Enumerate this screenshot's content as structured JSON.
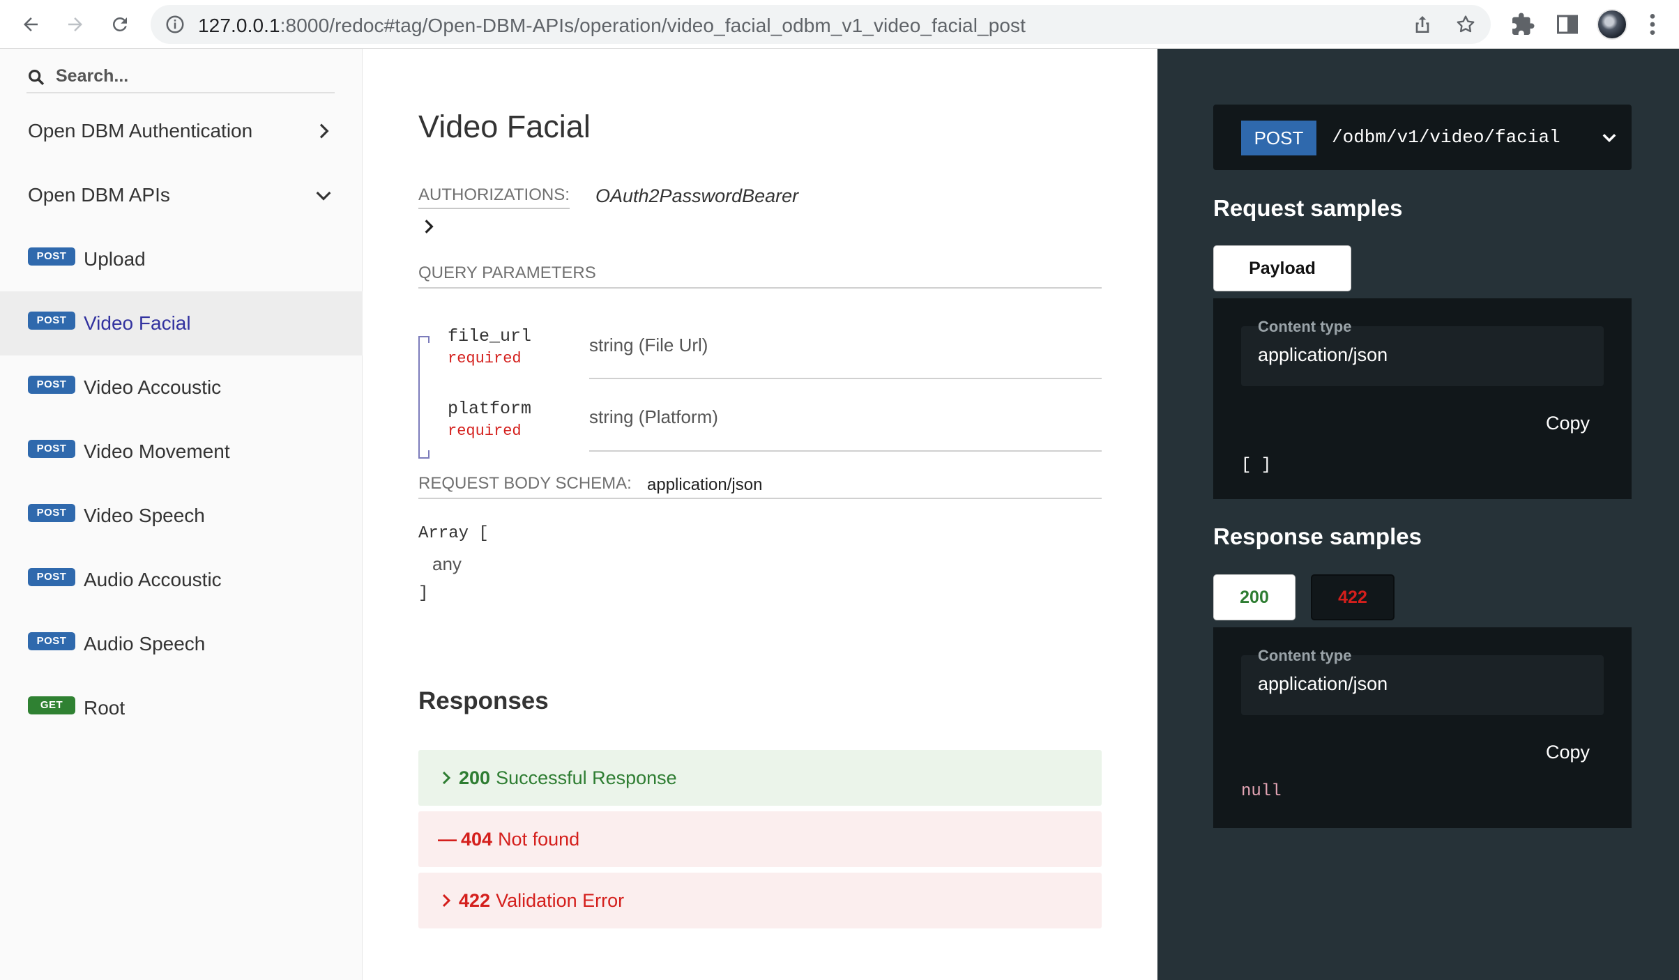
{
  "browser": {
    "url_host": "127.0.0.1",
    "url_rest": ":8000/redoc#tag/Open-DBM-APIs/operation/video_facial_odbm_v1_video_facial_post"
  },
  "sidebar": {
    "search_placeholder": "Search...",
    "groups": [
      {
        "label": "Open DBM Authentication",
        "expanded": false
      },
      {
        "label": "Open DBM APIs",
        "expanded": true
      }
    ],
    "operations": [
      {
        "method": "POST",
        "label": "Upload",
        "active": false
      },
      {
        "method": "POST",
        "label": "Video Facial",
        "active": true
      },
      {
        "method": "POST",
        "label": "Video Accoustic",
        "active": false
      },
      {
        "method": "POST",
        "label": "Video Movement",
        "active": false
      },
      {
        "method": "POST",
        "label": "Video Speech",
        "active": false
      },
      {
        "method": "POST",
        "label": "Audio Accoustic",
        "active": false
      },
      {
        "method": "POST",
        "label": "Audio Speech",
        "active": false
      },
      {
        "method": "GET",
        "label": "Root",
        "active": false
      }
    ]
  },
  "content": {
    "title": "Video Facial",
    "authorizations_label": "AUTHORIZATIONS:",
    "authorizations_value": "OAuth2PasswordBearer",
    "query_params_label": "QUERY PARAMETERS",
    "params": [
      {
        "name": "file_url",
        "required": "required",
        "type": "string (File Url)"
      },
      {
        "name": "platform",
        "required": "required",
        "type": "string (Platform)"
      }
    ],
    "request_body_label": "REQUEST BODY SCHEMA:",
    "request_body_type": "application/json",
    "schema": {
      "open": "Array [",
      "item": "any",
      "close": "]"
    },
    "responses_title": "Responses",
    "responses": [
      {
        "code": "200",
        "text": "Successful Response",
        "status": "success",
        "expanded": false
      },
      {
        "code": "404",
        "text": "Not found",
        "status": "error",
        "expanded": true
      },
      {
        "code": "422",
        "text": "Validation Error",
        "status": "error",
        "expanded": false
      }
    ]
  },
  "right_panel": {
    "method": "POST",
    "path": "/odbm/v1/video/facial",
    "request_heading": "Request samples",
    "request_tab": "Payload",
    "request_content_type_label": "Content type",
    "request_content_type": "application/json",
    "request_copy": "Copy",
    "request_code": "[ ]",
    "response_heading": "Response samples",
    "response_tabs": [
      "200",
      "422"
    ],
    "response_content_type_label": "Content type",
    "response_content_type": "application/json",
    "response_copy": "Copy",
    "response_code": "null"
  },
  "colors": {
    "post_badge": "#2f69ad",
    "get_badge": "#2f8132",
    "active_item_text": "#32329f",
    "required": "#d41f1c",
    "success": "#2e7d32",
    "error": "#d41f1c",
    "right_panel_bg": "#263238"
  }
}
